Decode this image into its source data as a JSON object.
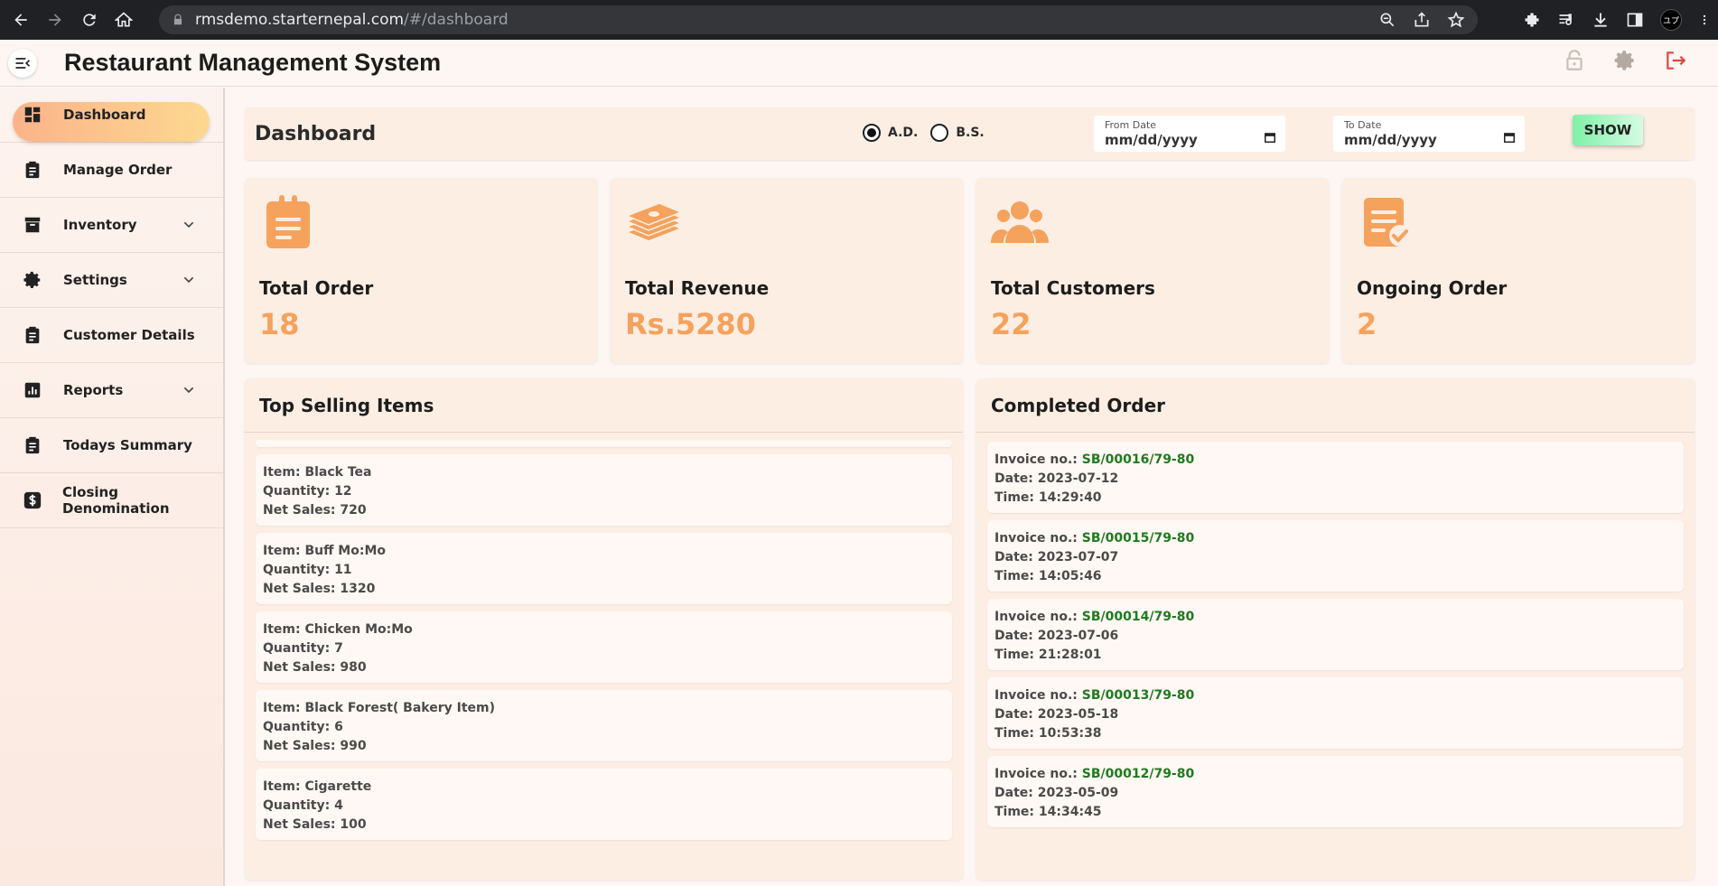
{
  "browser": {
    "url_host": "rmsdemo.starternepal.com",
    "url_path": "/#/dashboard",
    "profile_initials": "ユプ"
  },
  "app": {
    "title": "Restaurant Management System"
  },
  "sidebar": {
    "items": [
      {
        "label": "Dashboard",
        "icon": "dashboard-icon",
        "active": true,
        "has_submenu": false
      },
      {
        "label": "Manage Order",
        "icon": "clipboard-icon",
        "active": false,
        "has_submenu": false
      },
      {
        "label": "Inventory",
        "icon": "archive-icon",
        "active": false,
        "has_submenu": true
      },
      {
        "label": "Settings",
        "icon": "gear-icon",
        "active": false,
        "has_submenu": true
      },
      {
        "label": "Customer Details",
        "icon": "clipboard-icon",
        "active": false,
        "has_submenu": false
      },
      {
        "label": "Reports",
        "icon": "chart-icon",
        "active": false,
        "has_submenu": true
      },
      {
        "label": "Todays Summary",
        "icon": "clipboard-icon",
        "active": false,
        "has_submenu": false
      },
      {
        "label": "Closing Denomination",
        "icon": "dollar-icon",
        "active": false,
        "has_submenu": false
      }
    ]
  },
  "toolbar": {
    "page_title": "Dashboard",
    "calendar_options": [
      {
        "label": "A.D.",
        "selected": true
      },
      {
        "label": "B.S.",
        "selected": false
      }
    ],
    "from_date": {
      "caption": "From Date",
      "value": "mm/dd/yyyy"
    },
    "to_date": {
      "caption": "To Date",
      "value": "mm/dd/yyyy"
    },
    "show_label": "SHOW"
  },
  "stats": [
    {
      "label": "Total Order",
      "value": "18",
      "icon": "clipboard-icon"
    },
    {
      "label": "Total Revenue",
      "value": "Rs.5280",
      "icon": "money-stack-icon"
    },
    {
      "label": "Total Customers",
      "value": "22",
      "icon": "users-group-icon"
    },
    {
      "label": "Ongoing Order",
      "value": "2",
      "icon": "document-check-icon"
    }
  ],
  "top_selling": {
    "title": "Top Selling Items",
    "items": [
      {
        "item": "Item: Black Tea",
        "quantity": "Quantity: 12",
        "net_sales": "Net Sales: 720"
      },
      {
        "item": "Item: Buff Mo:Mo",
        "quantity": "Quantity: 11",
        "net_sales": "Net Sales: 1320"
      },
      {
        "item": "Item: Chicken Mo:Mo",
        "quantity": "Quantity: 7",
        "net_sales": "Net Sales: 980"
      },
      {
        "item": "Item: Black Forest( Bakery Item)",
        "quantity": "Quantity: 6",
        "net_sales": "Net Sales: 990"
      },
      {
        "item": "Item: Cigarette",
        "quantity": "Quantity: 4",
        "net_sales": "Net Sales: 100"
      }
    ]
  },
  "completed": {
    "title": "Completed Order",
    "invoice_prefix": "Invoice no.: ",
    "orders": [
      {
        "invoice": "SB/00016/79-80",
        "date": "Date: 2023-07-12",
        "time": "Time: 14:29:40"
      },
      {
        "invoice": "SB/00015/79-80",
        "date": "Date: 2023-07-07",
        "time": "Time: 14:05:46"
      },
      {
        "invoice": "SB/00014/79-80",
        "date": "Date: 2023-07-06",
        "time": "Time: 21:28:01"
      },
      {
        "invoice": "SB/00013/79-80",
        "date": "Date: 2023-05-18",
        "time": "Time: 10:53:38"
      },
      {
        "invoice": "SB/00012/79-80",
        "date": "Date: 2023-05-09",
        "time": "Time: 14:34:45"
      }
    ]
  },
  "colors": {
    "accent": "#f5a25d",
    "invoice_green": "#1f7a1f",
    "logout_red": "#e0443e"
  }
}
